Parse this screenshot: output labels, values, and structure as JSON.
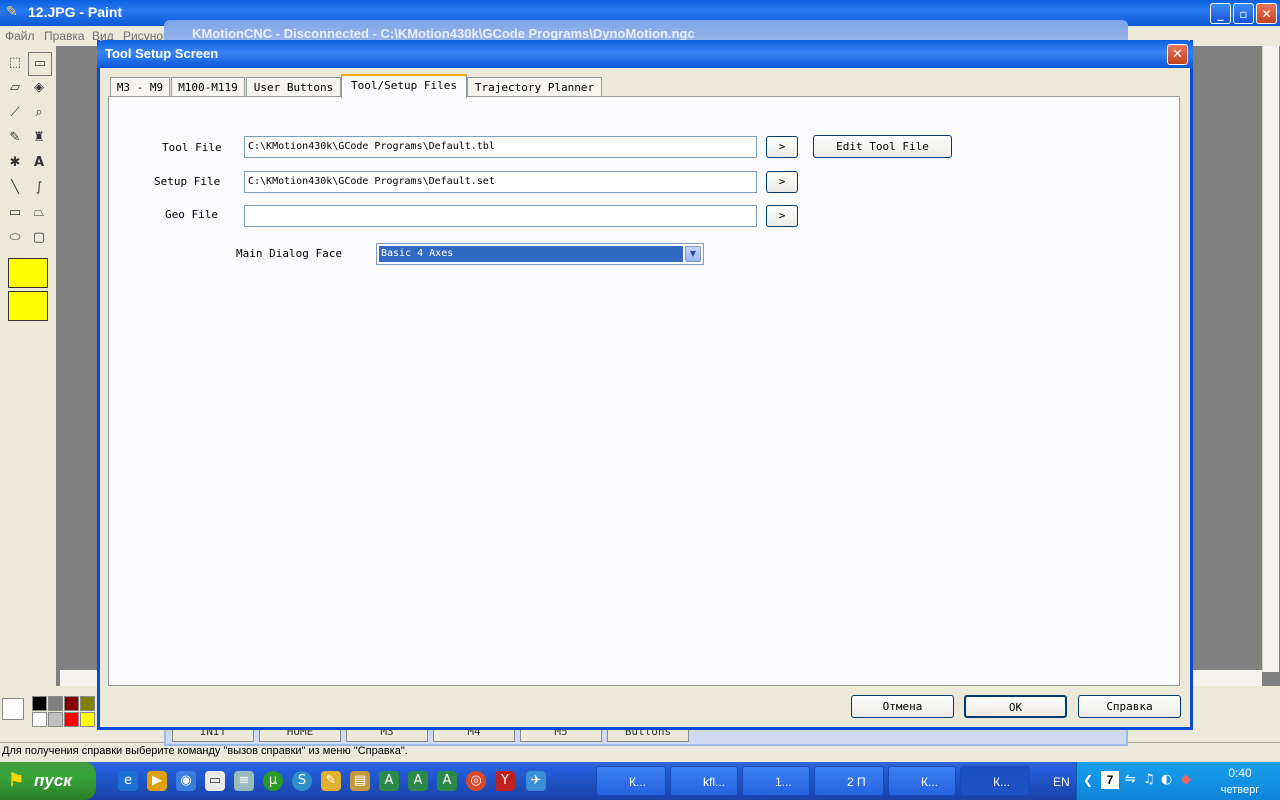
{
  "paint": {
    "title": "12.JPG - Paint",
    "menu": [
      "Файл",
      "Правка",
      "Вид",
      "Рисунок"
    ],
    "status": "Для получения справки выберите команду \"вызов справки\" из меню \"Справка\"."
  },
  "background_window": {
    "title": "KMotionCNC - Disconnected - C:\\KMotion430k\\GCode Programs\\DynoMotion.ngc",
    "buttons": [
      "INIT",
      "HOME",
      "M3",
      "M4",
      "M5",
      "Buttons"
    ]
  },
  "dialog": {
    "title": "Tool Setup Screen",
    "tabs": [
      "M3 - M9",
      "M100-M119",
      "User Buttons",
      "Tool/Setup Files",
      "Trajectory Planner"
    ],
    "active_tab": "Tool/Setup Files",
    "tool_file_label": "Tool File",
    "tool_file_value": "C:\\KMotion430k\\GCode Programs\\Default.tbl",
    "setup_file_label": "Setup File",
    "setup_file_value": "C:\\KMotion430k\\GCode Programs\\Default.set",
    "geo_file_label": "Geo File",
    "geo_file_value": "",
    "browse_label": ">",
    "edit_tool_file_label": "Edit Tool File",
    "main_dialog_face_label": "Main Dialog Face",
    "main_dialog_face_value": "Basic 4 Axes",
    "cancel_label": "Отмена",
    "ok_label": "OK",
    "help_label": "Справка"
  },
  "taskbar": {
    "start_label": "пуск",
    "items": [
      "К...",
      "kfl...",
      "1...",
      "2 П",
      "К...",
      "К..."
    ],
    "language": "EN",
    "time": "0:40",
    "day": "четверг"
  }
}
